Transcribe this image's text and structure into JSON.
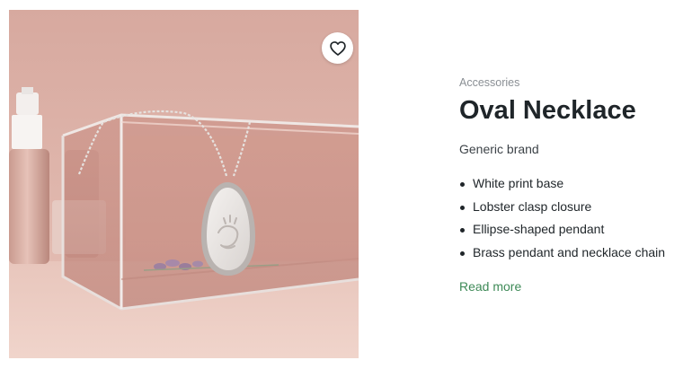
{
  "product": {
    "category": "Accessories",
    "title": "Oval Necklace",
    "brand": "Generic brand",
    "features": [
      "White print base",
      "Lobster clasp closure",
      "Ellipse-shaped pendant",
      "Brass pendant and necklace chain"
    ],
    "read_more_label": "Read more",
    "favorite_icon": "heart-outline-icon",
    "image_subject": "product-photo"
  },
  "colors": {
    "accent_link": "#3e8a57",
    "title_text": "#1f2529",
    "muted_text": "#8a8f94",
    "photo_background": "#d9aea4"
  }
}
